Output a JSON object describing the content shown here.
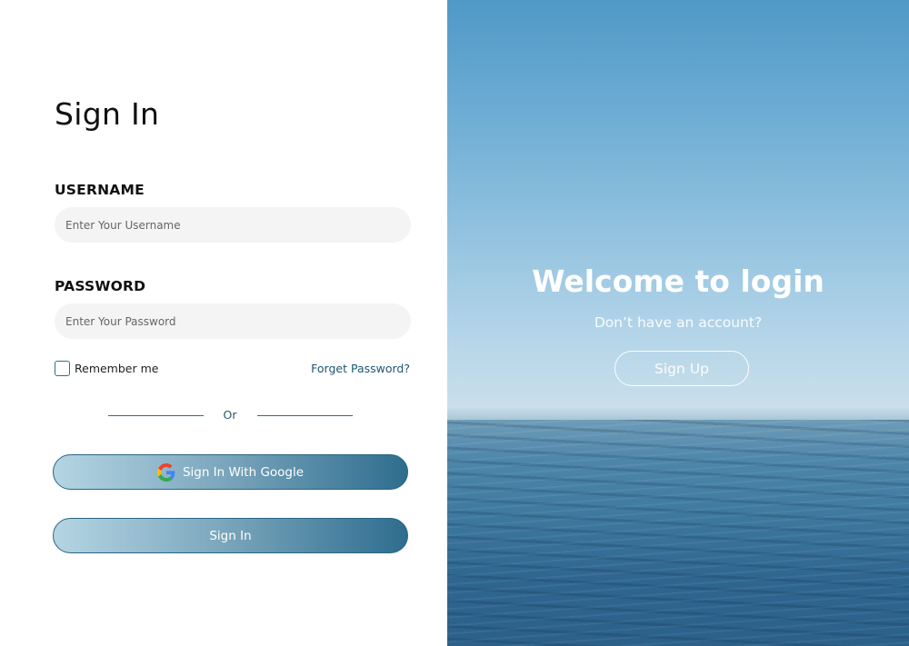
{
  "login": {
    "title": "Sign In",
    "username_label": "USERNAME",
    "username_placeholder": "Enter Your Username",
    "password_label": "PASSWORD",
    "password_placeholder": "Enter Your Password",
    "remember_label": "Remember me",
    "forgot_label": "Forget Password?",
    "divider_text": "Or",
    "google_button_label": "Sign In With Google",
    "signin_button_label": "Sign In"
  },
  "panel": {
    "welcome_title": "Welcome to login",
    "no_account_text": "Don’t have an account?",
    "signup_button_label": "Sign Up"
  },
  "colors": {
    "accent": "#2e6d8e",
    "input_bg": "#f4f4f4",
    "link": "#1e5670"
  },
  "icons": {
    "google": "google-g-icon",
    "checkbox": "checkbox-icon"
  }
}
